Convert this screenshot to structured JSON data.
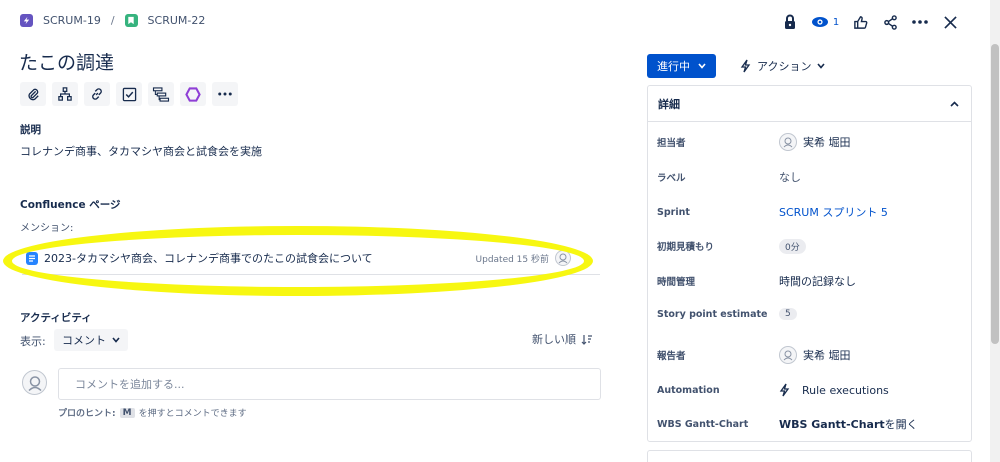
{
  "breadcrumb": {
    "parent": "SCRUM-19",
    "separator": "/",
    "current": "SCRUM-22"
  },
  "header": {
    "watch_count": "1"
  },
  "issue": {
    "title": "たこの調達",
    "description_label": "説明",
    "description": "コレナンデ商事、タカマシヤ商会と試食会を実施",
    "confluence_label": "Confluence ページ",
    "mentions_label": "メンション:",
    "confluence_page_title": "2023-タカマシヤ商会、コレナンデ商事でのたこの試食会について",
    "confluence_updated": "Updated 15 秒前"
  },
  "activity": {
    "heading": "アクティビティ",
    "show_label": "表示:",
    "filter_value": "コメント",
    "sort_label": "新しい順",
    "comment_placeholder": "コメントを追加する...",
    "tip_prefix": "プロのヒント:",
    "tip_key": "M",
    "tip_suffix": "を押すとコメントできます"
  },
  "sidebar": {
    "status": "進行中",
    "actions": "アクション",
    "details_title": "詳細",
    "fields": [
      {
        "label": "担当者",
        "value": "実希 堀田"
      },
      {
        "label": "ラベル",
        "value": "なし"
      },
      {
        "label": "Sprint",
        "value": "SCRUM スプリント 5"
      },
      {
        "label": "初期見積もり",
        "value": "0分"
      },
      {
        "label": "時間管理",
        "value": "時間の記録なし"
      },
      {
        "label": "Story point estimate",
        "value": "5"
      },
      {
        "label": "報告者",
        "value": "実希 堀田"
      },
      {
        "label": "Automation",
        "value": "Rule executions"
      },
      {
        "label": "WBS Gantt-Chart",
        "value_bold": "WBS Gantt-Chart",
        "value_rest": " を開く"
      }
    ]
  },
  "colors": {
    "primary": "#0052cc",
    "highlight": "#f7f711",
    "epic_purple": "#6554c0",
    "story_green": "#36b37e",
    "confluence_blue": "#2684ff"
  }
}
